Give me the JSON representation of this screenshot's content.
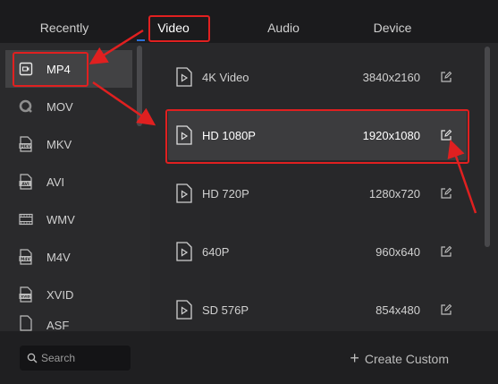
{
  "tabs": [
    {
      "label": "Recently"
    },
    {
      "label": "Video"
    },
    {
      "label": "Audio"
    },
    {
      "label": "Device"
    }
  ],
  "formats": [
    {
      "label": "MP4",
      "icon": "mp4-camera-icon"
    },
    {
      "label": "MOV",
      "icon": "quicktime-icon"
    },
    {
      "label": "MKV",
      "icon": "mkv-file-icon",
      "badge": "MKV"
    },
    {
      "label": "AVI",
      "icon": "avi-file-icon",
      "badge": "AVI"
    },
    {
      "label": "WMV",
      "icon": "wmv-film-icon"
    },
    {
      "label": "M4V",
      "icon": "m4v-file-icon",
      "badge": "M4V"
    },
    {
      "label": "XVID",
      "icon": "xvid-file-icon",
      "badge": "XVID"
    },
    {
      "label": "ASF",
      "icon": "asf-file-icon"
    }
  ],
  "search": {
    "placeholder": "Search"
  },
  "presets": [
    {
      "name": "4K Video",
      "resolution": "3840x2160"
    },
    {
      "name": "HD 1080P",
      "resolution": "1920x1080"
    },
    {
      "name": "HD 720P",
      "resolution": "1280x720"
    },
    {
      "name": "640P",
      "resolution": "960x640"
    },
    {
      "name": "SD 576P",
      "resolution": "854x480"
    }
  ],
  "create_custom": {
    "label": "Create Custom"
  },
  "colors": {
    "highlight": "#e02020",
    "accent": "#2b6fd8",
    "active_tab": "Video",
    "active_format": "MP4",
    "active_preset": "HD 1080P"
  }
}
